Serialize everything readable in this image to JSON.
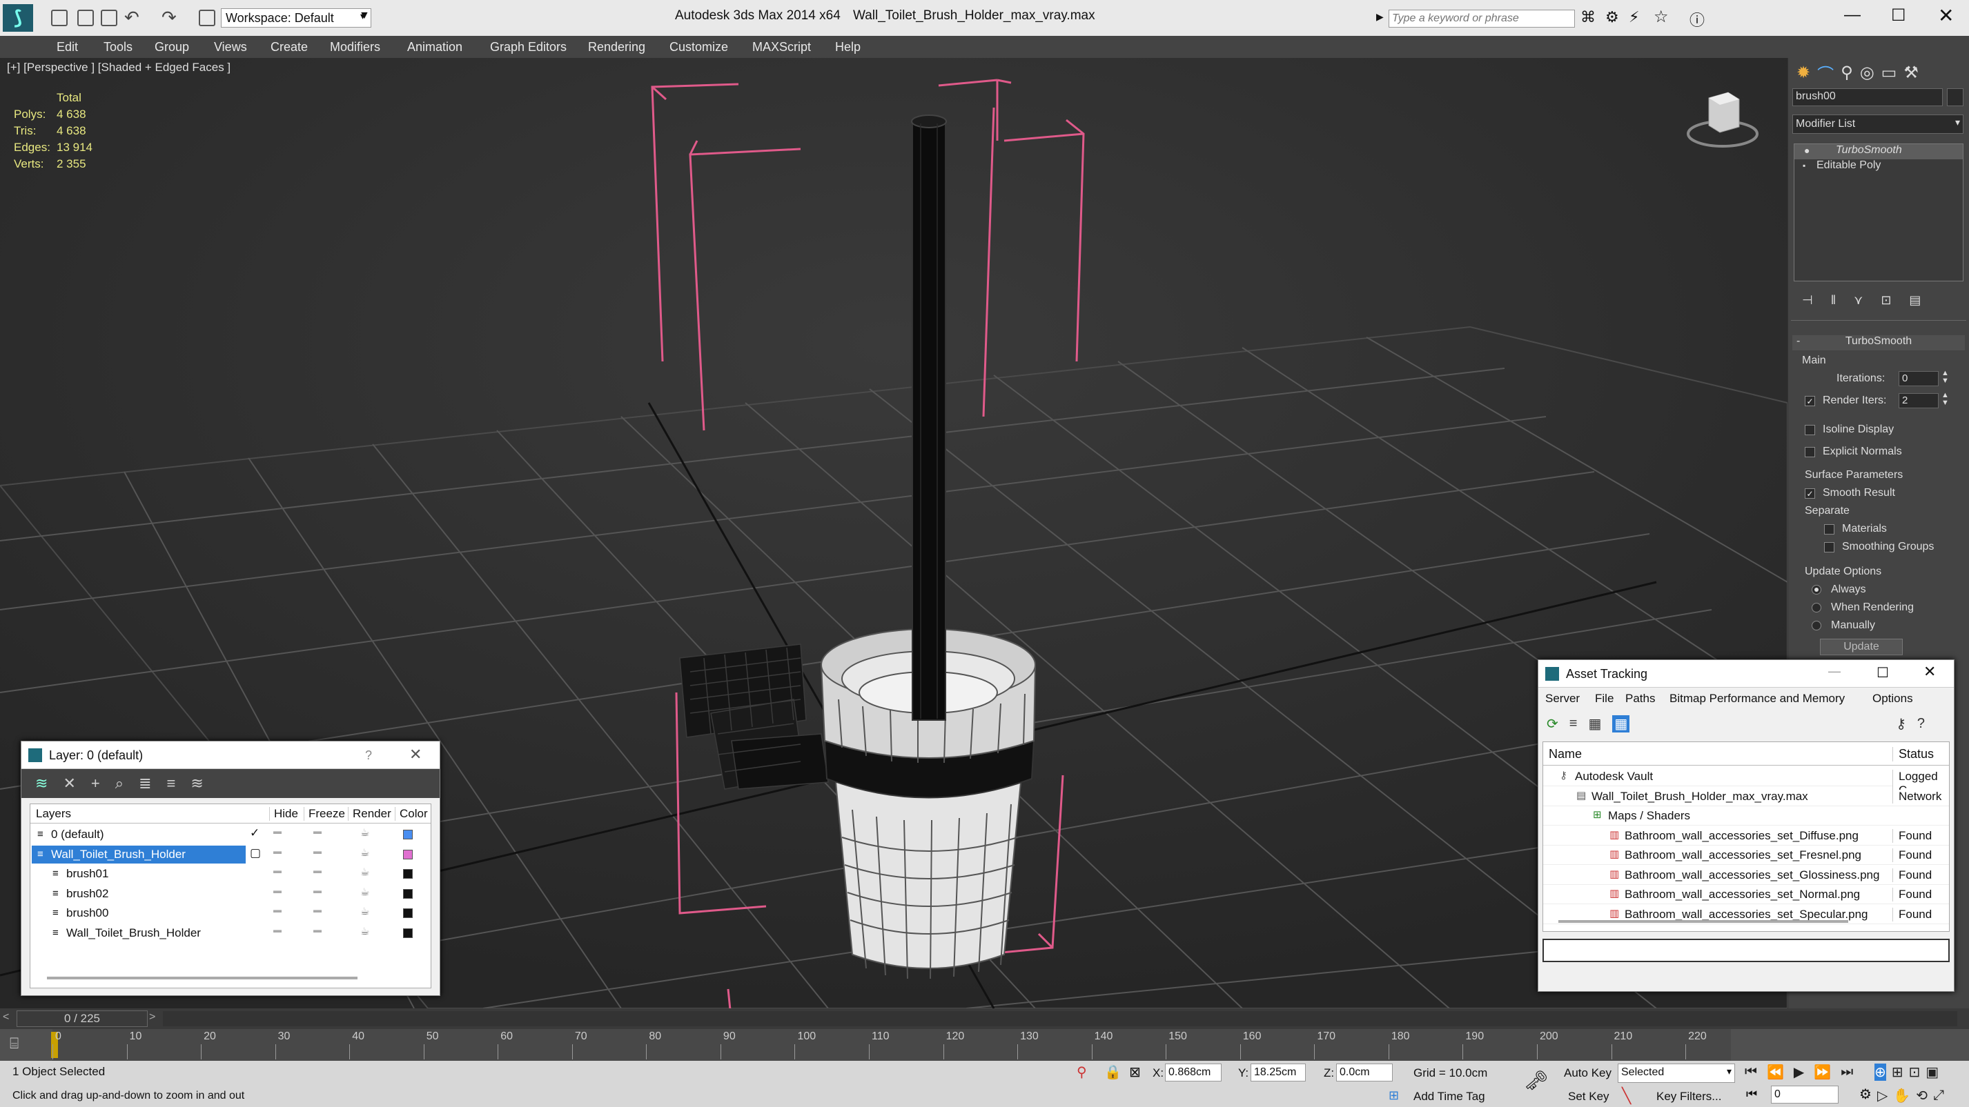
{
  "app": {
    "title": "Autodesk 3ds Max  2014 x64",
    "filename": "Wall_Toilet_Brush_Holder_max_vray.max",
    "workspace": "Workspace: Default",
    "search_placeholder": "Type a keyword or phrase"
  },
  "menu": [
    "Edit",
    "Tools",
    "Group",
    "Views",
    "Create",
    "Modifiers",
    "Animation",
    "Graph Editors",
    "Rendering",
    "Customize",
    "MAXScript",
    "Help"
  ],
  "viewport": {
    "label": "[+] [Perspective ] [Shaded + Edged Faces ]",
    "stats": {
      "header": "Total",
      "rows": [
        {
          "k": "Polys:",
          "v": "4 638"
        },
        {
          "k": "Tris:",
          "v": "4 638"
        },
        {
          "k": "Edges:",
          "v": "13 914"
        },
        {
          "k": "Verts:",
          "v": "2 355"
        }
      ]
    }
  },
  "command_panel": {
    "object_name": "brush00",
    "modifier_list": "Modifier List",
    "stack": [
      "TurboSmooth",
      "Editable Poly"
    ],
    "rollout": "TurboSmooth",
    "main": "Main",
    "iterations_label": "Iterations:",
    "iterations": "0",
    "render_iters_label": "Render Iters:",
    "render_iters": "2",
    "render_iters_checked": true,
    "isoline": "Isoline Display",
    "explicit": "Explicit Normals",
    "surface_params": "Surface Parameters",
    "smooth_result": "Smooth Result",
    "separate": "Separate",
    "materials": "Materials",
    "smoothing_groups": "Smoothing Groups",
    "update_options": "Update Options",
    "always": "Always",
    "when_rendering": "When Rendering",
    "manually": "Manually",
    "update_btn": "Update"
  },
  "layer_window": {
    "title": "Layer: 0 (default)",
    "help": "?",
    "columns": [
      "Layers",
      "Hide",
      "Freeze",
      "Render",
      "Color"
    ],
    "rows": [
      {
        "name": "0 (default)",
        "indent": 0,
        "selected": false,
        "color": "#4a8ef0",
        "check": "✓"
      },
      {
        "name": "Wall_Toilet_Brush_Holder",
        "indent": 0,
        "selected": true,
        "color": "#e070d0",
        "check": "▢"
      },
      {
        "name": "brush01",
        "indent": 1,
        "selected": false,
        "color": "#111111",
        "check": ""
      },
      {
        "name": "brush02",
        "indent": 1,
        "selected": false,
        "color": "#111111",
        "check": ""
      },
      {
        "name": "brush00",
        "indent": 1,
        "selected": false,
        "color": "#111111",
        "check": ""
      },
      {
        "name": "Wall_Toilet_Brush_Holder",
        "indent": 1,
        "selected": false,
        "color": "#111111",
        "check": ""
      }
    ]
  },
  "asset_window": {
    "title": "Asset Tracking",
    "menu": [
      "Server",
      "File",
      "Paths",
      "Bitmap Performance and Memory",
      "Options"
    ],
    "columns": [
      "Name",
      "Status"
    ],
    "rows": [
      {
        "name": "Autodesk Vault",
        "status": "Logged C",
        "indent": 1
      },
      {
        "name": "Wall_Toilet_Brush_Holder_max_vray.max",
        "status": "Network",
        "indent": 2
      },
      {
        "name": "Maps / Shaders",
        "status": "",
        "indent": 3
      },
      {
        "name": "Bathroom_wall_accessories_set_Diffuse.png",
        "status": "Found",
        "indent": 4
      },
      {
        "name": "Bathroom_wall_accessories_set_Fresnel.png",
        "status": "Found",
        "indent": 4
      },
      {
        "name": "Bathroom_wall_accessories_set_Glossiness.png",
        "status": "Found",
        "indent": 4
      },
      {
        "name": "Bathroom_wall_accessories_set_Normal.png",
        "status": "Found",
        "indent": 4
      },
      {
        "name": "Bathroom_wall_accessories_set_Specular.png",
        "status": "Found",
        "indent": 4
      }
    ]
  },
  "timeline": {
    "frame": "0 / 225",
    "ticks": [
      "0",
      "10",
      "20",
      "30",
      "40",
      "50",
      "60",
      "70",
      "80",
      "90",
      "100",
      "110",
      "120",
      "130",
      "140",
      "150",
      "160",
      "170",
      "180",
      "190",
      "200",
      "210",
      "220"
    ]
  },
  "status": {
    "selection": "1 Object Selected",
    "prompt": "Click and drag up-and-down to zoom in and out",
    "x_label": "X:",
    "x": "0.868cm",
    "y_label": "Y:",
    "y": "18.25cm",
    "z_label": "Z:",
    "z": "0.0cm",
    "grid": "Grid = 10.0cm",
    "add_time_tag": "Add Time Tag",
    "auto_key": "Auto Key",
    "set_key": "Set Key",
    "selected_dropdown": "Selected",
    "key_filters": "Key Filters...",
    "frame_field": "0"
  },
  "colors": {
    "accent": "#2f7fd6",
    "wire_pink": "#e05a8a",
    "viewport_bg": "#2c2c2c"
  }
}
